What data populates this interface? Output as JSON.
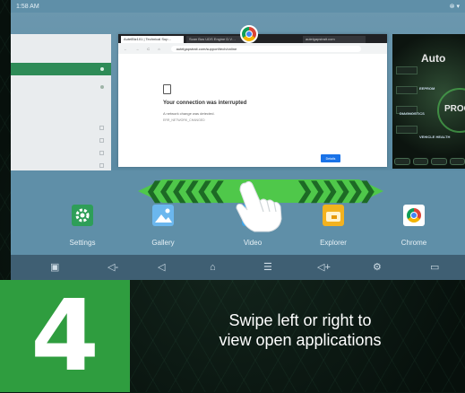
{
  "status_bar": {
    "time": "1:58 AM",
    "right_icons": "⊗ ▾"
  },
  "chrome_card": {
    "tabs": [
      "AutelBiz101 | Technical Sup…",
      "Scan Bus UDS Engine D.V…",
      "autelgapstrait.com"
    ],
    "nav_icons": "← → C ⌂",
    "url": "autelgapstrait.com/support/tech/online",
    "page_title": "Your connection was interrupted",
    "page_text": "A network change was detected.",
    "page_code": "ERR_NETWORK_CHANGED",
    "details_button": "Details"
  },
  "autel_card": {
    "logo": "Auto",
    "items": [
      "EEPROM",
      "DIAGNOSTICS",
      "VEHICLE HEALTH"
    ],
    "prog_label": "PROG"
  },
  "dock": {
    "apps": [
      {
        "label": "Settings",
        "icon": "gear-icon",
        "color": "#2e9e58"
      },
      {
        "label": "Gallery",
        "icon": "image-icon",
        "color": "#6bb7ee"
      },
      {
        "label": "Video",
        "icon": "video-icon",
        "color": "#3ba3e8"
      },
      {
        "label": "Explorer",
        "icon": "folder-icon",
        "color": "#f3b21f"
      },
      {
        "label": "Chrome",
        "icon": "chrome-icon",
        "color": "#ffffff"
      }
    ]
  },
  "navbar": {
    "screenshot": "▣",
    "volume_down": "◁-",
    "back": "◁",
    "home": "⌂",
    "menu": "☰",
    "volume_up": "◁+",
    "vci": "⚙",
    "extra": "▭"
  },
  "step": {
    "number": "4",
    "caption_line1": "Swipe left or right to",
    "caption_line2": "view open applications"
  },
  "colors": {
    "accent_green": "#2f9d3f",
    "swipe_green": "#4fc84a"
  }
}
